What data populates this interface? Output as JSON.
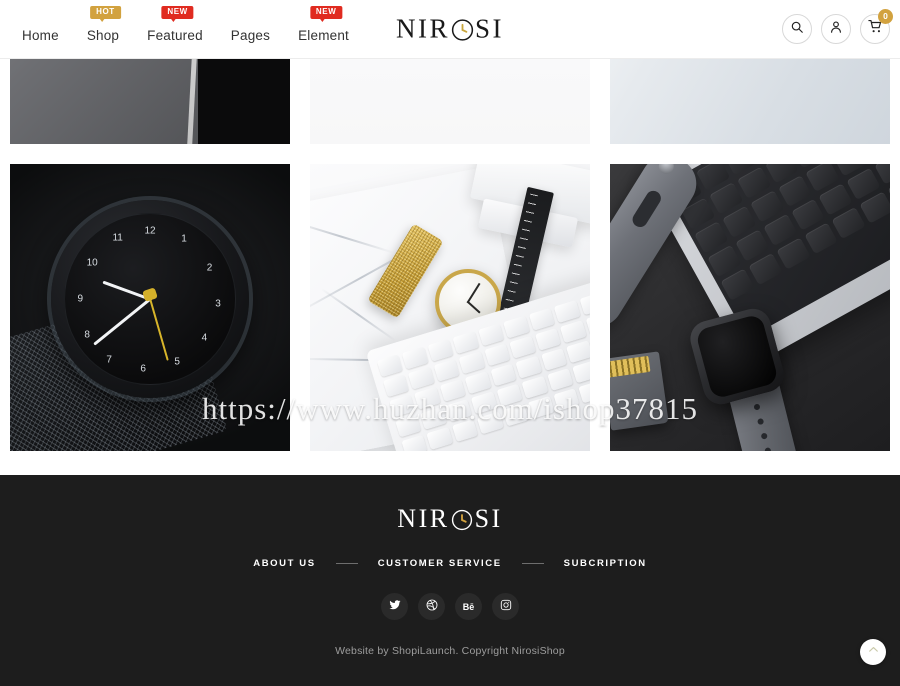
{
  "header": {
    "nav": [
      {
        "label": "Home",
        "badge": null,
        "badge_type": null
      },
      {
        "label": "Shop",
        "badge": "HOT",
        "badge_type": "hot"
      },
      {
        "label": "Featured",
        "badge": "NEW",
        "badge_type": "new"
      },
      {
        "label": "Pages",
        "badge": null,
        "badge_type": null
      },
      {
        "label": "Element",
        "badge": "NEW",
        "badge_type": "new"
      }
    ],
    "logo": {
      "part1": "NIR",
      "part2": "SI",
      "full": "NIROSI"
    },
    "icons": {
      "search": "search-icon",
      "account": "user-icon",
      "cart": "cart-icon",
      "cart_count": "0"
    }
  },
  "gallery": {
    "top_row": [
      {
        "alt": "watch-macro-grayscale"
      },
      {
        "alt": "black-watch-on-white"
      },
      {
        "alt": "light-blue-product"
      }
    ],
    "bottom_row": [
      {
        "alt": "black-dial-mesh-watch"
      },
      {
        "alt": "gold-mesh-watch-on-marble"
      },
      {
        "alt": "smartwatch-with-laptop"
      }
    ],
    "dial_numbers": [
      "1",
      "2",
      "3",
      "4",
      "5",
      "6",
      "7",
      "8",
      "9",
      "10",
      "11",
      "12"
    ]
  },
  "watermark": {
    "text": "https://www.huzhan.com/ishop37815"
  },
  "footer": {
    "logo": {
      "part1": "NIR",
      "part2": "SI",
      "full": "NIROSI"
    },
    "links": [
      {
        "label": "ABOUT US"
      },
      {
        "label": "CUSTOMER SERVICE"
      },
      {
        "label": "SUBCRIPTION"
      }
    ],
    "socials": [
      {
        "name": "twitter-icon",
        "glyph": "\u0000"
      },
      {
        "name": "dribbble-icon",
        "glyph": "\u0000"
      },
      {
        "name": "behance-icon",
        "glyph": "Bē"
      },
      {
        "name": "instagram-icon",
        "glyph": "\u0000"
      }
    ],
    "copyright": "Website by ShopiLaunch. Copyright NirosiShop",
    "to_top": "scroll-to-top"
  },
  "colors": {
    "badge_hot": "#d2a23f",
    "badge_new": "#e02b20",
    "footer_bg": "#1d1d1d",
    "accent_gold": "#d2a23f"
  }
}
